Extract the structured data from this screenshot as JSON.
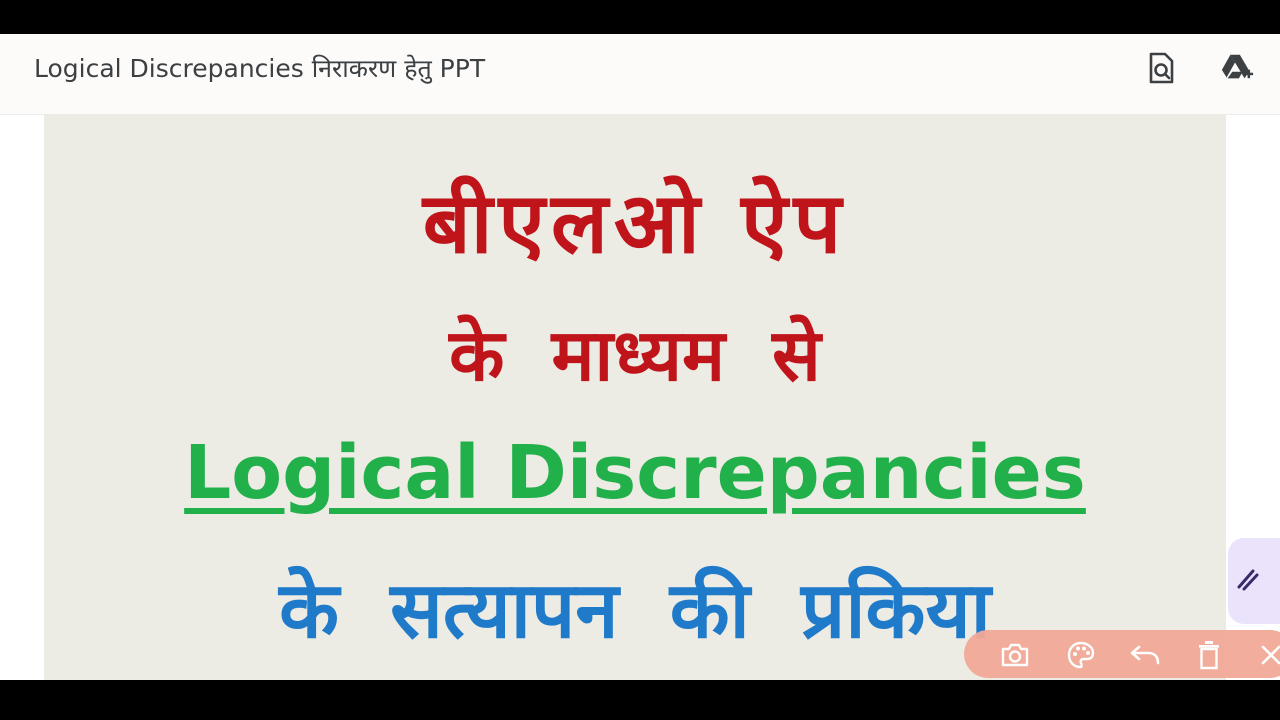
{
  "header": {
    "title": "Logical Discrepancies निराकरण हेतु PPT",
    "icons": [
      "search-document-icon",
      "google-drive-add-icon"
    ]
  },
  "slide": {
    "line1": "बीएलओ ऐप",
    "line2": "के माध्यम से",
    "line3": "Logical Discrepancies",
    "line4": "के सत्यापन की प्रकिया"
  },
  "toolbar": {
    "icons": [
      "camera-icon",
      "palette-icon",
      "undo-icon",
      "trash-icon",
      "close-icon"
    ]
  },
  "side_tab": {
    "icon": "pen-icon"
  },
  "colors": {
    "red_text": "#c0141b",
    "green_text": "#22b04b",
    "blue_text": "#1f7ac9",
    "slide_bg": "#ecebe4",
    "toolbar_bg": "#f2a998",
    "side_tab_bg": "#ebe3fb"
  }
}
